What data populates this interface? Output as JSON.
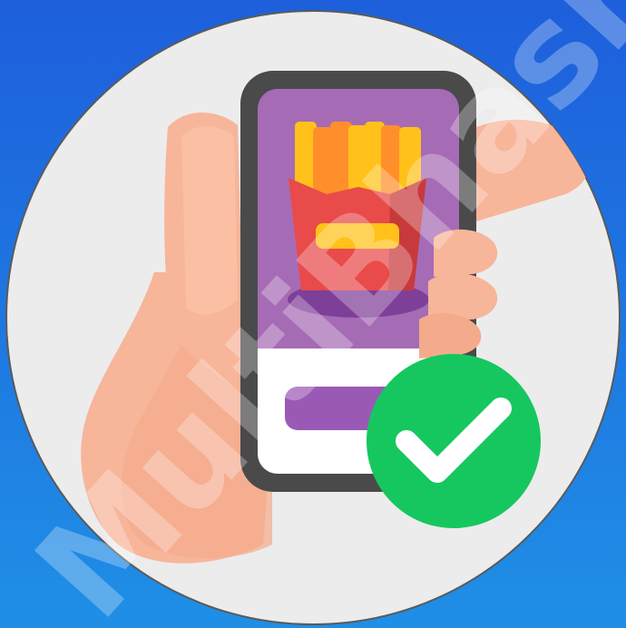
{
  "scene": {
    "description_name": "order-confirmed-illustration",
    "colors": {
      "background_top": "#1e5fdc",
      "background_bottom": "#1f8fe6",
      "circle_fill": "#ececec",
      "circle_border": "#5a5a5a",
      "phone_frame": "#4a4a4a",
      "screen_purple": "#a66bb5",
      "screen_white": "#ffffff",
      "purple_button": "#9b59b6",
      "fries_yellow": "#ffc11a",
      "fries_orange": "#ff8f2a",
      "fries_box_red": "#e94a4a",
      "fries_box_dark": "#c8393b",
      "fries_box_label": "#ffc11a",
      "shadow_purple": "#7e3f98",
      "hand_skin": "#f7b59a",
      "hand_light": "#ffc7ad",
      "check_green": "#16c75f",
      "check_white": "#ffffff"
    },
    "icons": {
      "phone": "smartphone-icon",
      "fries": "french-fries-icon",
      "hand": "hand-icon",
      "check": "check-circle-icon"
    }
  },
  "watermark": {
    "text": "MultiBhashi"
  }
}
